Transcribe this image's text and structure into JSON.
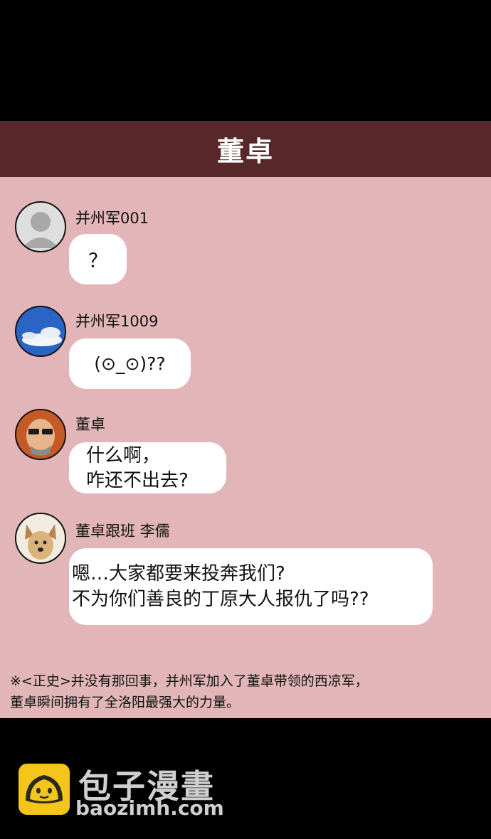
{
  "header": {
    "title": "董卓"
  },
  "messages": [
    {
      "sender": "并州军001",
      "lines": [
        "？"
      ]
    },
    {
      "sender": "并州军1009",
      "lines": [
        "(⊙_⊙)??"
      ]
    },
    {
      "sender": "董卓",
      "lines": [
        "什么啊，",
        "咋还不出去?"
      ]
    },
    {
      "sender": "董卓跟班 李儒",
      "lines": [
        "嗯…大家都要来投奔我们?",
        "不为你们善良的丁原大人报仇了吗??"
      ]
    }
  ],
  "note": {
    "lines": [
      "※<正史>并没有那回事，并州军加入了董卓带领的西凉军，",
      "董卓瞬间拥有了全洛阳最强大的力量。"
    ]
  },
  "watermark": {
    "name": "包子漫畫",
    "url": "baozimh.com"
  },
  "colors": {
    "header_bg": "#58272a",
    "chat_bg": "#e2b6b8",
    "bubble_bg": "#ffffff",
    "logo_bg": "#f4c51b"
  }
}
